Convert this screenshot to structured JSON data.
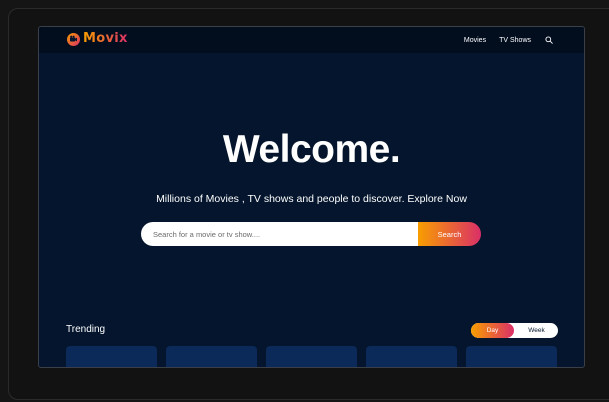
{
  "brand": {
    "name": "Movix"
  },
  "nav": {
    "items": [
      {
        "label": "Movies"
      },
      {
        "label": "TV Shows"
      }
    ]
  },
  "hero": {
    "title": "Welcome.",
    "subtitle": "Millions of Movies , TV shows and people to discover. Explore Now",
    "search_placeholder": "Search for a movie or tv show....",
    "search_button": "Search"
  },
  "trending": {
    "title": "Trending",
    "tabs": [
      {
        "label": "Day",
        "active": true
      },
      {
        "label": "Week",
        "active": false
      }
    ],
    "card_count": 5
  },
  "colors": {
    "background": "#04152d",
    "navbar": "#020d1e",
    "accent_start": "#f89e00",
    "accent_end": "#da2f68",
    "card": "#0c2a59"
  }
}
